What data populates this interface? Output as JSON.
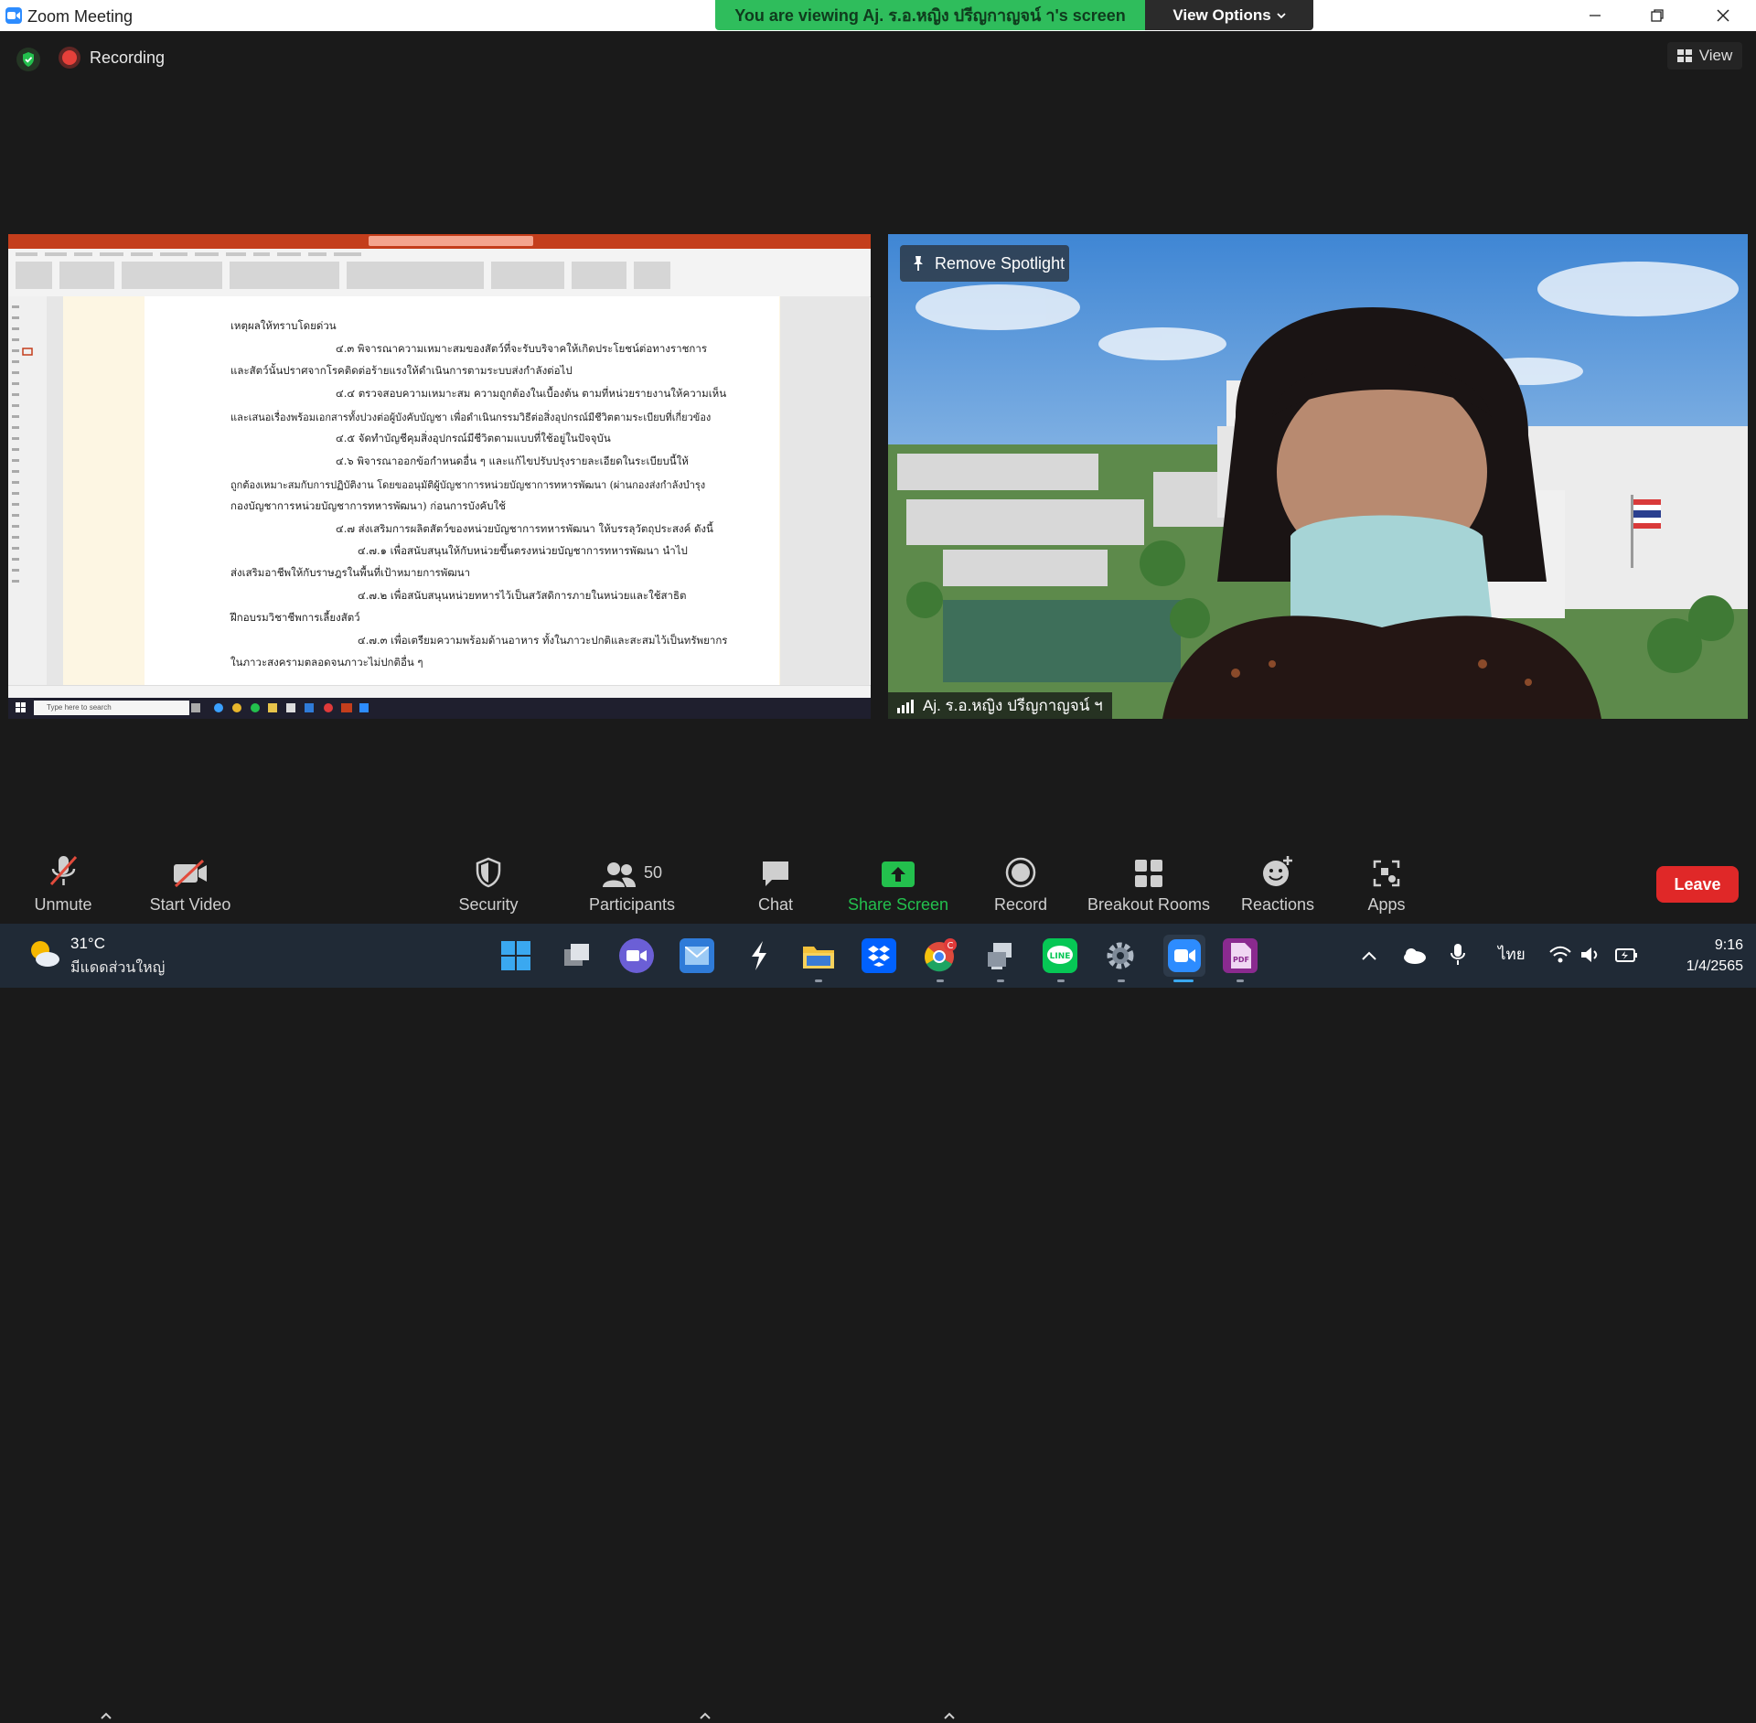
{
  "window": {
    "title": "Zoom Meeting",
    "minimize": "minimize",
    "maximize": "maximize",
    "close": "close"
  },
  "banner": {
    "text": "You are viewing Aj. ร.อ.หญิง ปรีญกาญจน์ า's screen",
    "view_options": "View Options"
  },
  "status": {
    "recording": "Recording",
    "view": "View"
  },
  "shared_screen": {
    "search": "ค้นหา (Alt+Q)",
    "taskbar_search": "Type here to search",
    "document_lines": [
      "เหตุผลให้ทราบโดยด่วน",
      "๔.๓ พิจารณาความเหมาะสมของสัตว์ที่จะรับบริจาคให้เกิดประโยชน์ต่อทางราชการ",
      "และสัตว์นั้นปราศจากโรคติดต่อร้ายแรงให้ดำเนินการตามระบบส่งกำลังต่อไป",
      "๔.๔ ตรวจสอบความเหมาะสม ความถูกต้องในเบื้องต้น ตามที่หน่วยรายงานให้ความเห็น",
      "และเสนอเรื่องพร้อมเอกสารทั้งปวงต่อผู้บังคับบัญชา เพื่อดำเนินกรรมวิธีต่อสิ่งอุปกรณ์มีชีวิตตามระเบียบที่เกี่ยวข้อง",
      "๔.๕ จัดทำบัญชีคุมสิ่งอุปกรณ์มีชีวิตตามแบบที่ใช้อยู่ในปัจจุบัน",
      "๔.๖ พิจารณาออกข้อกำหนดอื่น ๆ และแก้ไขปรับปรุงรายละเอียดในระเบียบนี้ให้",
      "ถูกต้องเหมาะสมกับการปฏิบัติงาน โดยขออนุมัติผู้บัญชาการหน่วยบัญชาการทหารพัฒนา (ผ่านกองส่งกำลังบำรุง",
      "กองบัญชาการหน่วยบัญชาการทหารพัฒนา) ก่อนการบังคับใช้",
      "๔.๗ ส่งเสริมการผลิตสัตว์ของหน่วยบัญชาการทหารพัฒนา ให้บรรลุวัตถุประสงค์ ดังนี้",
      "๔.๗.๑ เพื่อสนับสนุนให้กับหน่วยขึ้นตรงหน่วยบัญชาการทหารพัฒนา นำไป",
      "ส่งเสริมอาชีพให้กับราษฎรในพื้นที่เป้าหมายการพัฒนา",
      "๔.๗.๒ เพื่อสนับสนุนหน่วยทหารไว้เป็นสวัสดิการภายในหน่วยและใช้สาธิต",
      "ฝึกอบรมวิชาชีพการเลี้ยงสัตว์",
      "๔.๗.๓ เพื่อเตรียมความพร้อมด้านอาหาร ทั้งในภาวะปกติและสะสมไว้เป็นทรัพยากร",
      "ในภาวะสงครามตลอดจนภาวะไม่ปกติอื่น ๆ"
    ]
  },
  "video": {
    "spotlight": "Remove Spotlight",
    "participant_name": "Aj. ร.อ.หญิง ปรีญกาญจน์ ฯ"
  },
  "toolbar": {
    "unmute": "Unmute",
    "start_video": "Start Video",
    "security": "Security",
    "participants": "Participants",
    "participants_count": "50",
    "chat": "Chat",
    "share_screen": "Share Screen",
    "record": "Record",
    "breakout_rooms": "Breakout Rooms",
    "reactions": "Reactions",
    "apps": "Apps",
    "leave": "Leave"
  },
  "taskbar": {
    "temperature": "31°C",
    "condition": "มีแดดส่วนใหญ่",
    "language": "ไทย",
    "time": "9:16",
    "date": "1/4/2565",
    "chrome_badge": "C",
    "line_label": "LINE",
    "pdf_label": "PDF"
  },
  "colors": {
    "banner_green": "#2fbd5c",
    "share_green": "#23c04d",
    "leave_red": "#e02828",
    "zoom_blue": "#2d8cff",
    "powerpoint_red": "#c43e1c"
  }
}
